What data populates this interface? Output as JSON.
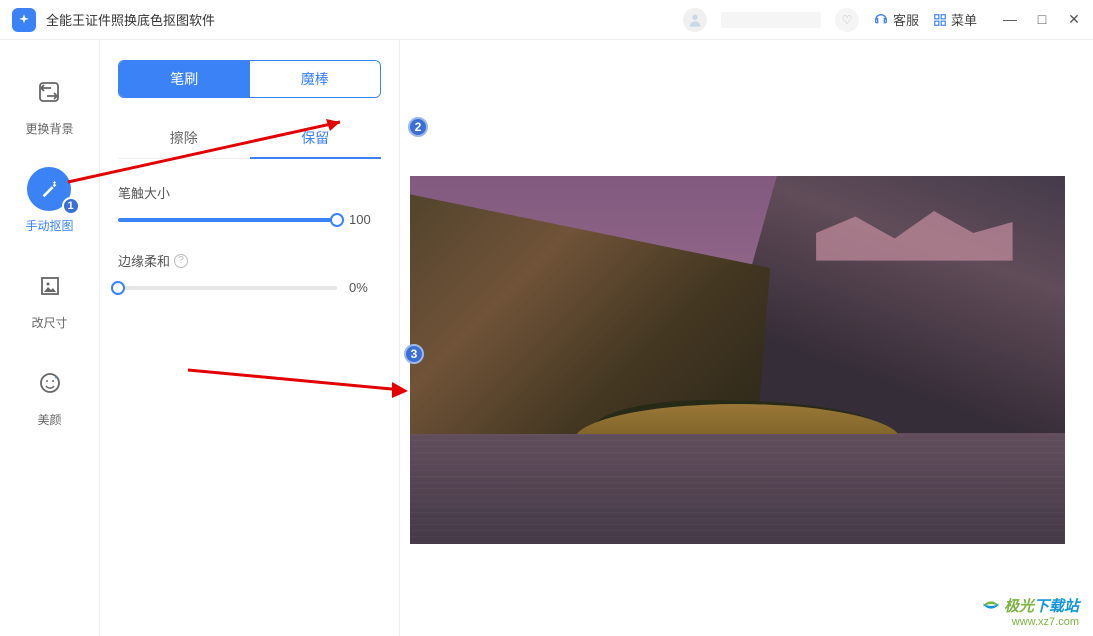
{
  "app": {
    "title": "全能王证件照换底色抠图软件"
  },
  "titlebar": {
    "customer_service": "客服",
    "menu": "菜单",
    "minimize": "—",
    "maximize": "□",
    "close": "✕"
  },
  "sidebar": {
    "items": [
      {
        "label": "更换背景",
        "icon": "swap"
      },
      {
        "label": "手动抠图",
        "icon": "wand"
      },
      {
        "label": "改尺寸",
        "icon": "resize"
      },
      {
        "label": "美颜",
        "icon": "beauty"
      }
    ],
    "active_index": 1
  },
  "panel": {
    "mode_tabs": {
      "brush": "笔刷",
      "wand": "魔棒",
      "active": "brush"
    },
    "sub_tabs": {
      "erase": "擦除",
      "keep": "保留",
      "active": "keep"
    },
    "brush_size": {
      "label": "笔触大小",
      "value": 100,
      "display": "100",
      "min": 0,
      "max": 100
    },
    "edge_soft": {
      "label": "边缘柔和",
      "value": 0,
      "display": "0%",
      "min": 0,
      "max": 100
    }
  },
  "annotations": {
    "step1": "1",
    "step2": "2",
    "step3": "3"
  },
  "watermark": {
    "brand": "极光下载站",
    "url": "www.xz7.com"
  }
}
